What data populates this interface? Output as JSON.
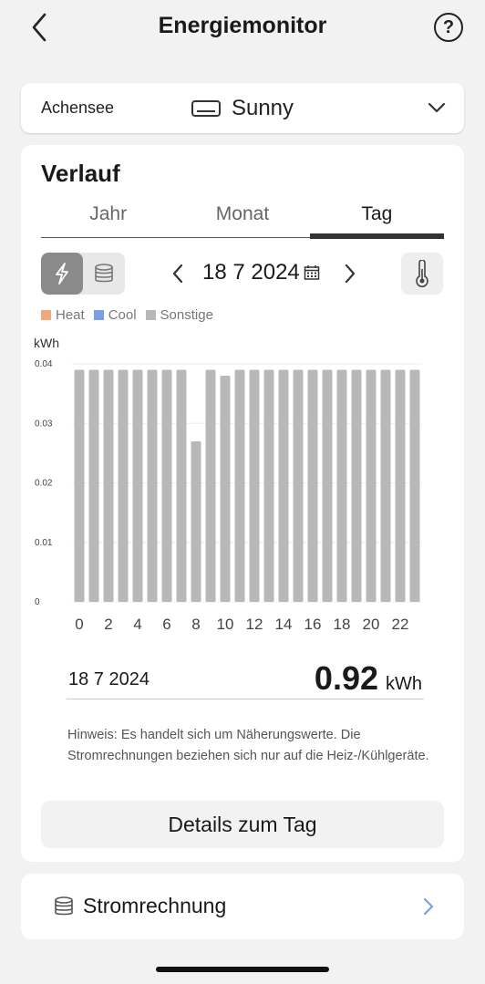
{
  "header": {
    "title": "Energiemonitor"
  },
  "device_bar": {
    "location": "Achensee",
    "device_name": "Sunny"
  },
  "section": {
    "title": "Verlauf"
  },
  "tabs": [
    {
      "label": "Jahr",
      "active": false
    },
    {
      "label": "Monat",
      "active": false
    },
    {
      "label": "Tag",
      "active": true
    }
  ],
  "mode": {
    "selected": "power"
  },
  "date_nav": {
    "date": "18 7 2024"
  },
  "colors": {
    "heat": "#f0a97a",
    "cool": "#7b9ee8",
    "other": "#b8b8b8",
    "accent": "#333333"
  },
  "chart_data": {
    "type": "bar",
    "ylabel": "kWh",
    "ylim": [
      0,
      0.04
    ],
    "yticks": [
      "0.04",
      "0.03",
      "0.02",
      "0.01",
      "0"
    ],
    "ytick_values": [
      0.04,
      0.03,
      0.02,
      0.01,
      0
    ],
    "xtick_labels": [
      "0",
      "2",
      "4",
      "6",
      "8",
      "10",
      "12",
      "14",
      "16",
      "18",
      "20",
      "22"
    ],
    "categories": [
      "0",
      "1",
      "2",
      "3",
      "4",
      "5",
      "6",
      "7",
      "8",
      "9",
      "10",
      "11",
      "12",
      "13",
      "14",
      "15",
      "16",
      "17",
      "18",
      "19",
      "20",
      "21",
      "22",
      "23"
    ],
    "legend": [
      "Heat",
      "Cool",
      "Sonstige"
    ],
    "legend_placement": "top-left",
    "series": [
      {
        "name": "Heat",
        "values": [
          0,
          0,
          0,
          0,
          0,
          0,
          0,
          0,
          0,
          0,
          0,
          0,
          0,
          0,
          0,
          0,
          0,
          0,
          0,
          0,
          0,
          0,
          0,
          0
        ]
      },
      {
        "name": "Cool",
        "values": [
          0,
          0,
          0,
          0,
          0,
          0,
          0,
          0,
          0,
          0,
          0,
          0,
          0,
          0,
          0,
          0,
          0,
          0,
          0,
          0,
          0,
          0,
          0,
          0
        ]
      },
      {
        "name": "Sonstige",
        "values": [
          0.039,
          0.039,
          0.039,
          0.039,
          0.039,
          0.039,
          0.039,
          0.039,
          0.027,
          0.039,
          0.038,
          0.039,
          0.039,
          0.039,
          0.039,
          0.039,
          0.039,
          0.039,
          0.039,
          0.039,
          0.039,
          0.039,
          0.039,
          0.039
        ]
      }
    ],
    "grid": true
  },
  "summary": {
    "date": "18 7 2024",
    "value": "0.92",
    "unit": "kWh"
  },
  "hint": {
    "text": "Hinweis: Es handelt sich um Näherungswerte. Die Stromrechnungen beziehen sich nur auf die Heiz-/Kühlgeräte."
  },
  "details_button": {
    "label": "Details zum Tag"
  },
  "bill": {
    "label": "Stromrechnung"
  }
}
